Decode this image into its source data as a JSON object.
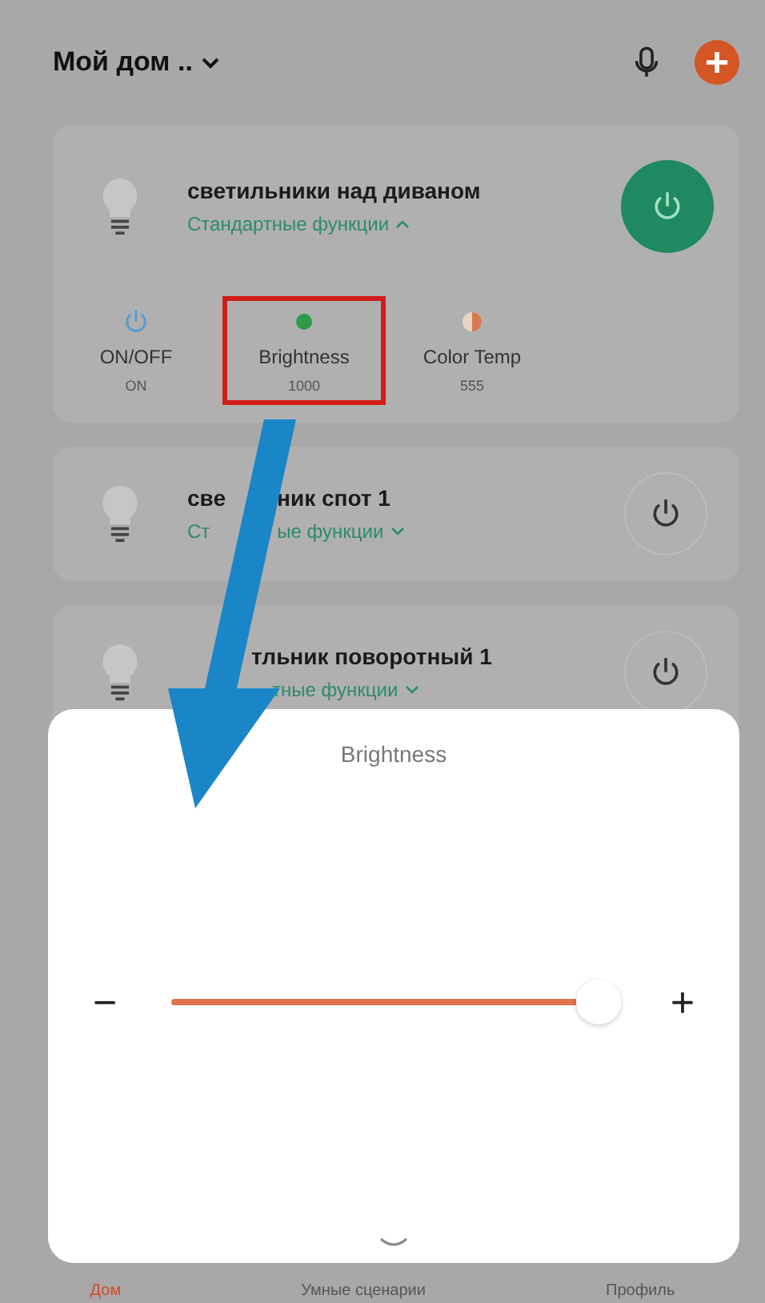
{
  "header": {
    "title": "Мой дом .."
  },
  "devices": [
    {
      "name_parts": [
        "светильники над диваном"
      ],
      "subtitle_parts": [
        "Стандартные функции"
      ],
      "expanded": true,
      "on": true,
      "functions": [
        {
          "kind": "power",
          "label": "ON/OFF",
          "value": "ON",
          "highlighted": false
        },
        {
          "kind": "brightness",
          "label": "Brightness",
          "value": "1000",
          "highlighted": true
        },
        {
          "kind": "colortemp",
          "label": "Color Temp",
          "value": "555",
          "highlighted": false
        }
      ]
    },
    {
      "name_parts": [
        "све",
        "ник спот 1"
      ],
      "subtitle_parts": [
        "Ст",
        "ые функции"
      ],
      "expanded": false,
      "on": false
    },
    {
      "name_parts": [
        "тльник поворотный 1"
      ],
      "subtitle_parts": [
        "тные функции"
      ],
      "expanded": false,
      "on": false
    }
  ],
  "sheet": {
    "title": "Brightness",
    "minus": "−",
    "plus": "+",
    "level": 0.96
  },
  "nav": [
    {
      "label": "Дом",
      "selected": true
    },
    {
      "label": "Умные сценарии",
      "selected": false
    },
    {
      "label": "Профиль",
      "selected": false
    }
  ]
}
